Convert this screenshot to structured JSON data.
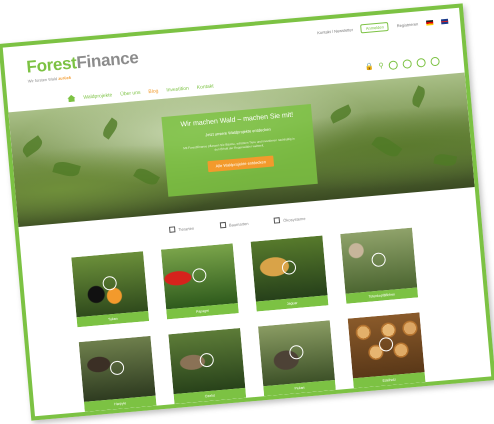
{
  "colors": {
    "brand_green": "#7cc243",
    "accent_orange": "#f39a2c",
    "frame_green": "#7cc243"
  },
  "logo": {
    "forest": "Forest",
    "finance": "Finance",
    "tagline": "Wir forsten Wald",
    "tagline_accent": "zurück"
  },
  "top_links": [
    {
      "label": "Kontakt / Newsletter"
    },
    {
      "label": "Anmelden"
    },
    {
      "label": "Registrieren"
    }
  ],
  "nav": {
    "home_icon": "home-icon",
    "items": [
      {
        "label": "Waldprojekte"
      },
      {
        "label": "Über uns"
      },
      {
        "label": "Blog"
      },
      {
        "label": "Investition"
      },
      {
        "label": "Kontakt"
      }
    ]
  },
  "tools": {
    "lock_icon": "lock-icon",
    "search_icon": "search-icon",
    "social_icons": [
      "facebook-icon",
      "twitter-icon",
      "youtube-icon",
      "mail-icon"
    ]
  },
  "hero": {
    "title": "Wir machen Wald – machen Sie mit!",
    "subtitle": "Jetzt unsere Waldprojekte entdecken",
    "text": "Mit ForestFinance pflanzen Sie Bäume, schützen Tiere und investieren nachhaltig in den Erhalt der Regenwälder weltweit.",
    "button": "Alle Waldprojekte entdecken"
  },
  "filters": [
    {
      "label": "Tierarten"
    },
    {
      "label": "Baumarten"
    },
    {
      "label": "Ökosysteme"
    }
  ],
  "cards": [
    {
      "label": "Tukan",
      "icon": "bird-icon"
    },
    {
      "label": "Papagei",
      "icon": "bird-icon"
    },
    {
      "label": "Jaguar",
      "icon": "paw-icon"
    },
    {
      "label": "Totenkopfäffchen",
      "icon": "monkey-icon"
    },
    {
      "label": "Harpyie",
      "icon": "bird-icon"
    },
    {
      "label": "Ozelot",
      "icon": "paw-icon"
    },
    {
      "label": "Pekari",
      "icon": "paw-icon"
    },
    {
      "label": "Edelholz",
      "icon": "tree-icon"
    }
  ]
}
